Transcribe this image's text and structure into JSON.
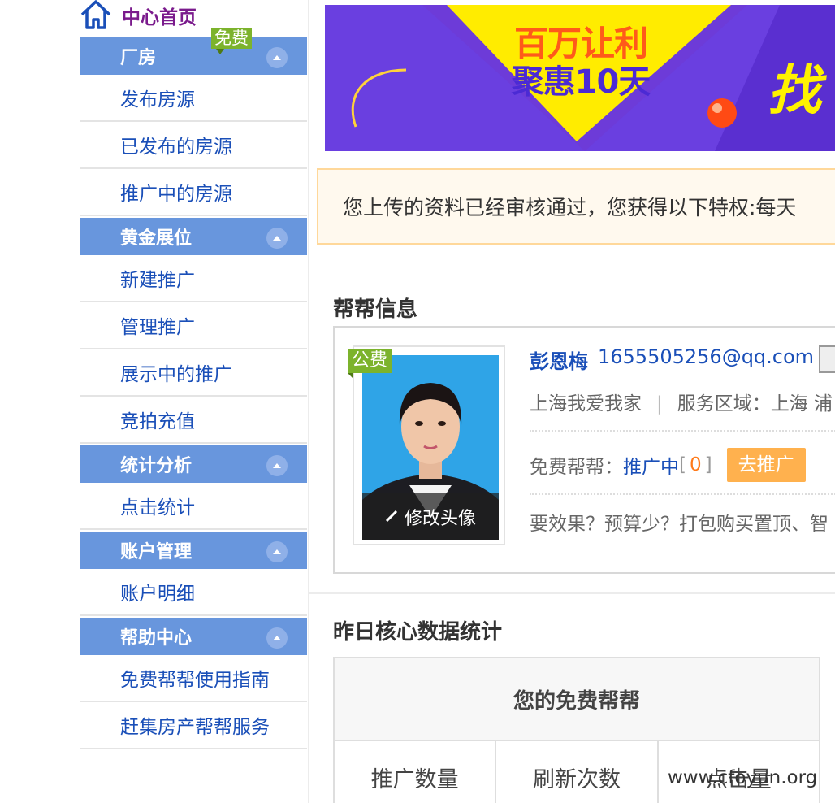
{
  "sidebar": {
    "home_label": "中心首页",
    "free_badge": "免费",
    "sections": [
      {
        "title": "厂房",
        "items": [
          "发布房源",
          "已发布的房源",
          "推广中的房源"
        ]
      },
      {
        "title": "黄金展位",
        "items": [
          "新建推广",
          "管理推广",
          "展示中的推广",
          "竞拍充值"
        ]
      },
      {
        "title": "统计分析",
        "items": [
          "点击统计"
        ]
      },
      {
        "title": "账户管理",
        "items": [
          "账户明细"
        ]
      },
      {
        "title": "帮助中心",
        "items": [
          "免费帮帮使用指南",
          "赶集房产帮帮服务"
        ]
      }
    ]
  },
  "banner": {
    "line1": "百万让利",
    "line2": "聚惠10天",
    "line3": "找"
  },
  "notice": {
    "text": "您上传的资料已经审核通过，您获得以下特权:每天"
  },
  "profile_section": {
    "title": "帮帮信息",
    "public_badge": "公费",
    "avatar_edit": "修改头像",
    "name": "彭恩梅",
    "email": "1655505256@qq.com",
    "company": "上海我爱我家",
    "service_area": "服务区域：上海 浦",
    "free_label": "免费帮帮：",
    "status": "推广中",
    "count": "0",
    "promote_button": "去推广",
    "promo_text": "要效果？预算少？打包购买置顶、智"
  },
  "stats_section": {
    "title": "昨日核心数据统计",
    "table_title": "您的免费帮帮",
    "columns": [
      "推广数量",
      "刷新次数",
      "点击量"
    ]
  },
  "watermark": "www.cfoyun.org",
  "colors": {
    "sidebar_header": "#6896dd",
    "link_blue": "#1a4fb8",
    "badge_green": "#7cb32c",
    "promote_orange": "#ffb14e",
    "home_purple": "#7a1a8c"
  }
}
